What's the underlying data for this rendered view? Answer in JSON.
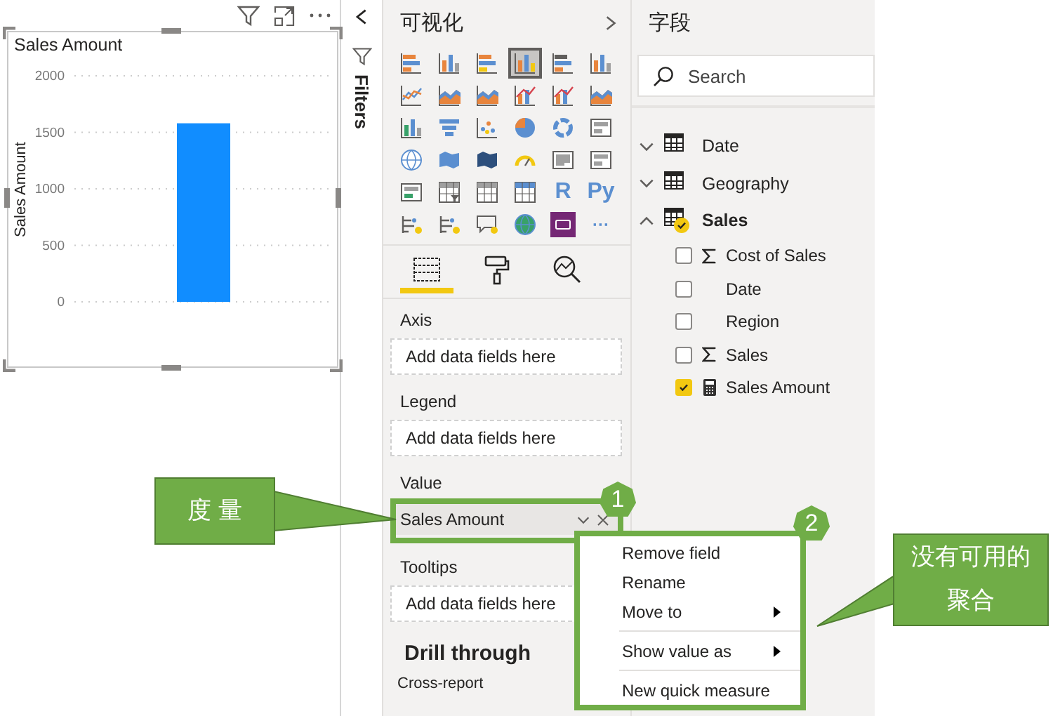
{
  "report_visual": {
    "chart_data": {
      "type": "bar",
      "title": "Sales Amount",
      "ylabel": "Sales Amount",
      "values": [
        1580
      ],
      "ylim": [
        0,
        2000
      ],
      "grid": true,
      "yticks": [
        0,
        500,
        1000,
        1500,
        2000
      ]
    }
  },
  "filters_pane": {
    "label": "Filters"
  },
  "visualizations": {
    "title": "可视化",
    "visual_types": [
      {
        "kind": "stacked-bar",
        "selected": false
      },
      {
        "kind": "stacked-column",
        "selected": false
      },
      {
        "kind": "clustered-bar",
        "selected": false
      },
      {
        "kind": "clustered-column",
        "selected": true
      },
      {
        "kind": "bar-100",
        "selected": false
      },
      {
        "kind": "column-100",
        "selected": false
      },
      {
        "kind": "line",
        "selected": false
      },
      {
        "kind": "area",
        "selected": false
      },
      {
        "kind": "stacked-area",
        "selected": false
      },
      {
        "kind": "line-column",
        "selected": false
      },
      {
        "kind": "line-clustered",
        "selected": false
      },
      {
        "kind": "ribbon",
        "selected": false
      },
      {
        "kind": "waterfall",
        "selected": false
      },
      {
        "kind": "funnel",
        "selected": false
      },
      {
        "kind": "scatter",
        "selected": false
      },
      {
        "kind": "pie",
        "selected": false
      },
      {
        "kind": "donut",
        "selected": false
      },
      {
        "kind": "treemap",
        "selected": false
      },
      {
        "kind": "map",
        "selected": false
      },
      {
        "kind": "filled-map",
        "selected": false
      },
      {
        "kind": "shape-map",
        "selected": false
      },
      {
        "kind": "gauge",
        "selected": false
      },
      {
        "kind": "card",
        "selected": false
      },
      {
        "kind": "multi-row-card",
        "selected": false
      },
      {
        "kind": "kpi",
        "selected": false
      },
      {
        "kind": "slicer",
        "selected": false
      },
      {
        "kind": "table",
        "selected": false
      },
      {
        "kind": "matrix",
        "selected": false
      },
      {
        "kind": "text",
        "text": "R",
        "selected": false
      },
      {
        "kind": "text",
        "text": "Py",
        "selected": false
      },
      {
        "kind": "influencers",
        "selected": false
      },
      {
        "kind": "decomposition",
        "selected": false
      },
      {
        "kind": "qa",
        "selected": false
      },
      {
        "kind": "globe",
        "selected": false
      },
      {
        "kind": "custom",
        "selected": false
      },
      {
        "kind": "text",
        "text": "···",
        "selected": false
      }
    ],
    "build_tabs": [
      {
        "kind": "fields",
        "selected": true
      },
      {
        "kind": "format",
        "selected": false
      },
      {
        "kind": "analytics",
        "selected": false
      }
    ],
    "wells": [
      {
        "label": "Axis",
        "hint": "Add data fields here"
      },
      {
        "label": "Legend",
        "hint": "Add data fields here"
      },
      {
        "label": "Value",
        "field": "Sales Amount"
      },
      {
        "label": "Tooltips",
        "hint": "Add data fields here"
      }
    ],
    "drill_through": {
      "title": "Drill through",
      "option": "Cross-report"
    }
  },
  "fields": {
    "title": "字段",
    "search": {
      "placeholder": "Search"
    },
    "tables": [
      {
        "name": "Date",
        "expanded": false,
        "in_use": false
      },
      {
        "name": "Geography",
        "expanded": false,
        "in_use": false
      },
      {
        "name": "Sales",
        "expanded": true,
        "in_use": true,
        "children": [
          {
            "name": "Cost of Sales",
            "kind": "sum",
            "checked": false
          },
          {
            "name": "Date",
            "kind": "plain",
            "checked": false
          },
          {
            "name": "Region",
            "kind": "plain",
            "checked": false
          },
          {
            "name": "Sales",
            "kind": "sum",
            "checked": false
          },
          {
            "name": "Sales Amount",
            "kind": "measure",
            "checked": true
          }
        ]
      }
    ]
  },
  "context_menu": {
    "groups": [
      [
        {
          "label": "Remove field",
          "submenu": false
        },
        {
          "label": "Rename",
          "submenu": false
        },
        {
          "label": "Move to",
          "submenu": true
        }
      ],
      [
        {
          "label": "Show value as",
          "submenu": true
        }
      ],
      [
        {
          "label": "New quick measure",
          "submenu": false
        }
      ]
    ]
  },
  "step_badges": [
    "1",
    "2"
  ],
  "callouts": [
    {
      "lines": [
        "度 量"
      ]
    },
    {
      "lines": [
        "没有可用的",
        "聚合"
      ]
    }
  ]
}
